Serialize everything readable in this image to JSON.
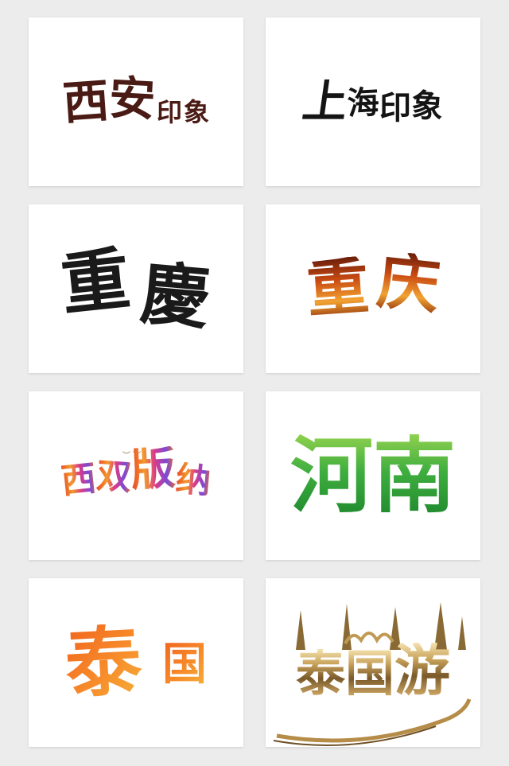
{
  "tiles": [
    {
      "id": "xian",
      "main": [
        "西",
        "安"
      ],
      "sub": [
        "印",
        "象"
      ]
    },
    {
      "id": "shanghai",
      "main": [
        "上"
      ],
      "sub": [
        "海",
        "印",
        "象"
      ]
    },
    {
      "id": "chongqing-trad",
      "chars": [
        "重",
        "慶"
      ]
    },
    {
      "id": "chongqing-fire",
      "chars": [
        "重",
        "庆"
      ]
    },
    {
      "id": "xishuangbanna",
      "chars": [
        "西",
        "双",
        "版",
        "纳"
      ]
    },
    {
      "id": "henan",
      "chars": [
        "河",
        "南"
      ]
    },
    {
      "id": "thailand",
      "main": [
        "泰"
      ],
      "sub": [
        "国"
      ]
    },
    {
      "id": "thailand-tour",
      "chars": [
        "泰",
        "国",
        "游"
      ]
    }
  ],
  "colors": {
    "background": "#ececec",
    "tile": "#ffffff",
    "xian": "#4a1a14",
    "ink": "#141414",
    "fire": "#e0721b",
    "henan_green": "#3aa53a",
    "thailand_orange": "#f07025",
    "gold": "#a8803e"
  }
}
